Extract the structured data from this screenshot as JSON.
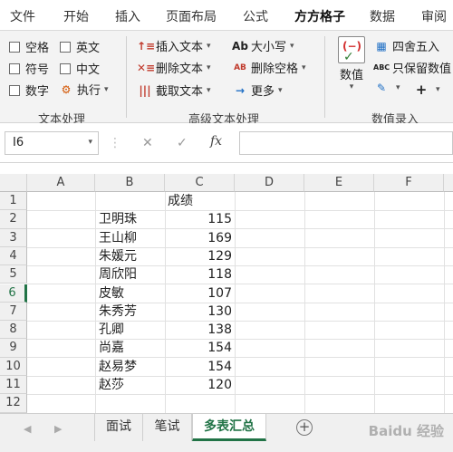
{
  "ribbon_tabs": [
    "文件",
    "开始",
    "插入",
    "页面布局",
    "公式",
    "方方格子",
    "数据",
    "审阅"
  ],
  "active_tab": "方方格子",
  "text_group": {
    "checkboxes": [
      "空格",
      "英文",
      "符号",
      "中文",
      "数字"
    ],
    "exec_label": "执行",
    "label": "文本处理"
  },
  "advanced_group": {
    "insert_text": "插入文本",
    "delete_text": "删除文本",
    "extract_text": "截取文本",
    "case": "大小写",
    "case_icon": "Ab",
    "delete_space": "删除空格",
    "delete_space_icon": "AB",
    "more": "更多",
    "label": "高级文本处理"
  },
  "number_group": {
    "value_label": "数值",
    "round_label": "四舍五入",
    "keep_value_label": "只保留数值",
    "keep_value_icon": "ABC",
    "label": "数值录入"
  },
  "formula_bar": {
    "cell_ref": "I6",
    "fx": "fx",
    "content": ""
  },
  "columns": [
    "A",
    "B",
    "C",
    "D",
    "E",
    "F"
  ],
  "rows": [
    "1",
    "2",
    "3",
    "4",
    "5",
    "6",
    "7",
    "8",
    "9",
    "10",
    "11",
    "12"
  ],
  "table": {
    "header": "成绩",
    "names": [
      "卫明珠",
      "王山柳",
      "朱媛元",
      "周欣阳",
      "皮敏",
      "朱秀芳",
      "孔卿",
      "尚嘉",
      "赵易梦",
      "赵莎"
    ],
    "scores": [
      "115",
      "169",
      "129",
      "118",
      "107",
      "130",
      "138",
      "154",
      "154",
      "120"
    ]
  },
  "sheets": [
    "面试",
    "笔试",
    "多表汇总"
  ],
  "active_sheet": "多表汇总",
  "watermark": "Baidu 经验",
  "colors": {
    "accent": "#217346",
    "ribbon_bg": "#f3f3f3"
  }
}
